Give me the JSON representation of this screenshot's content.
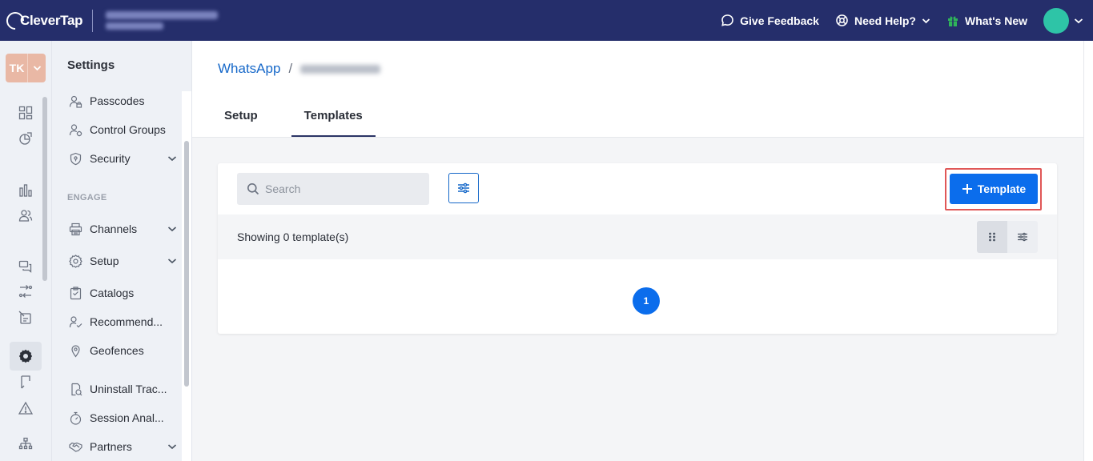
{
  "topbar": {
    "logo_text": "CleverTap",
    "give_feedback": "Give Feedback",
    "need_help": "Need Help?",
    "whats_new": "What's New"
  },
  "rail": {
    "account_initials": "TK"
  },
  "settings": {
    "title": "Settings",
    "items": [
      {
        "label": "Passcodes",
        "icon": "passcode-icon"
      },
      {
        "label": "Control Groups",
        "icon": "control-groups-icon"
      },
      {
        "label": "Security",
        "icon": "shield-icon",
        "expandable": true
      },
      {
        "label": "Channels",
        "icon": "channels-icon",
        "expandable": true
      },
      {
        "label": "Setup",
        "icon": "gear-icon",
        "expandable": true
      },
      {
        "label": "Catalogs",
        "icon": "catalog-icon"
      },
      {
        "label": "Recommend...",
        "icon": "recommend-icon"
      },
      {
        "label": "Geofences",
        "icon": "location-pin-icon"
      },
      {
        "label": "Uninstall Trac...",
        "icon": "uninstall-icon"
      },
      {
        "label": "Session Anal...",
        "icon": "stopwatch-icon"
      },
      {
        "label": "Partners",
        "icon": "handshake-icon",
        "expandable": true
      }
    ],
    "group_engage": "ENGAGE"
  },
  "main": {
    "breadcrumb_root": "WhatsApp",
    "breadcrumb_sep": "/",
    "tabs": [
      {
        "label": "Setup",
        "active": false
      },
      {
        "label": "Templates",
        "active": true
      }
    ],
    "search_placeholder": "Search",
    "add_template_label": "Template",
    "showing_text": "Showing 0 template(s)",
    "current_page": "1"
  },
  "colors": {
    "topbar_bg": "#252e6b",
    "primary": "#0b6dec",
    "link": "#1668c9",
    "highlight_border": "#e05757",
    "avatar": "#2ec4a7",
    "gift": "#2fb45a"
  }
}
